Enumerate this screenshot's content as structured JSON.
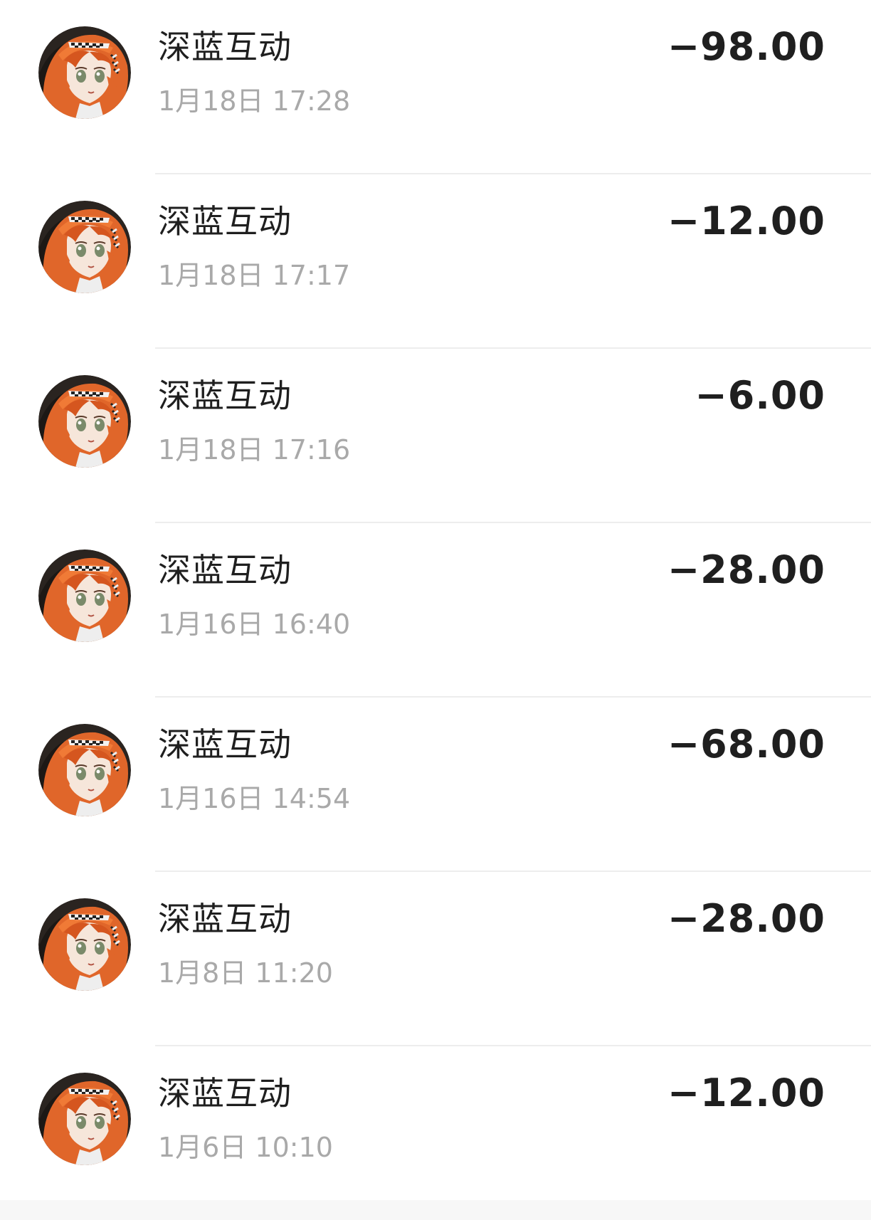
{
  "transactions": [
    {
      "merchant": "深蓝互动",
      "time": "1月18日 17:28",
      "amount": "−98.00"
    },
    {
      "merchant": "深蓝互动",
      "time": "1月18日 17:17",
      "amount": "−12.00"
    },
    {
      "merchant": "深蓝互动",
      "time": "1月18日 17:16",
      "amount": "−6.00"
    },
    {
      "merchant": "深蓝互动",
      "time": "1月16日 16:40",
      "amount": "−28.00"
    },
    {
      "merchant": "深蓝互动",
      "time": "1月16日 14:54",
      "amount": "−68.00"
    },
    {
      "merchant": "深蓝互动",
      "time": "1月8日 11:20",
      "amount": "−28.00"
    },
    {
      "merchant": "深蓝互动",
      "time": "1月6日 10:10",
      "amount": "−12.00"
    }
  ],
  "avatar_icon": "anime-girl-avatar-icon",
  "colors": {
    "text_primary": "#1f1f1f",
    "text_secondary": "#a9a9a9",
    "hair_orange": "#e0662a",
    "divider": "#ededed"
  }
}
